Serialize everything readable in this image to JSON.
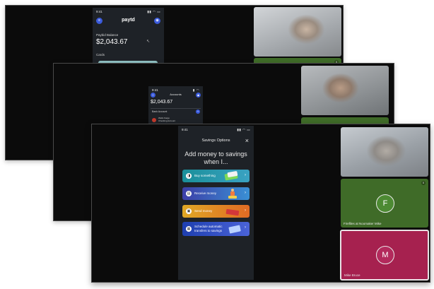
{
  "window_back": {
    "phone": {
      "time": "9:41",
      "logo": "paytd",
      "balance_label": "Paybid Balance",
      "balance": "$2,043.67",
      "cards_label": "Cards"
    },
    "tiles": [
      {
        "type": "video"
      },
      {
        "type": "green",
        "badge": "5"
      }
    ]
  },
  "window_middle": {
    "phone": {
      "time": "9:41",
      "title": "Accounts",
      "balance": "$2,043.67",
      "section": "Bank Account",
      "row_line1": "Wells Fargo",
      "row_line2": "Checking Account"
    },
    "tiles": [
      {
        "type": "video"
      },
      {
        "type": "green"
      }
    ]
  },
  "window_front": {
    "phone": {
      "time": "9:41",
      "title": "Savings Options",
      "heading_line1": "Add money to savings",
      "heading_line2": "when I...",
      "options": [
        {
          "label": "Buy something",
          "icon": "bag-icon",
          "color": "#1a8f9a"
        },
        {
          "label": "Receive money",
          "icon": "wallet-icon",
          "color": "#3d3fa8"
        },
        {
          "label": "Send money",
          "icon": "send-icon",
          "color": "#e0a825"
        },
        {
          "label": "Schedule automatic transfers to savings",
          "icon": "calendar-icon",
          "color": "#1e3fb0"
        }
      ]
    },
    "participants": [
      {
        "type": "video"
      },
      {
        "type": "avatar",
        "initial": "F",
        "name": "Firefiles at Noomaker Mike",
        "badge": "5",
        "color": "#3f6b28"
      },
      {
        "type": "avatar",
        "initial": "M",
        "name": "Mike Bruce",
        "color": "#a6214f"
      }
    ]
  }
}
